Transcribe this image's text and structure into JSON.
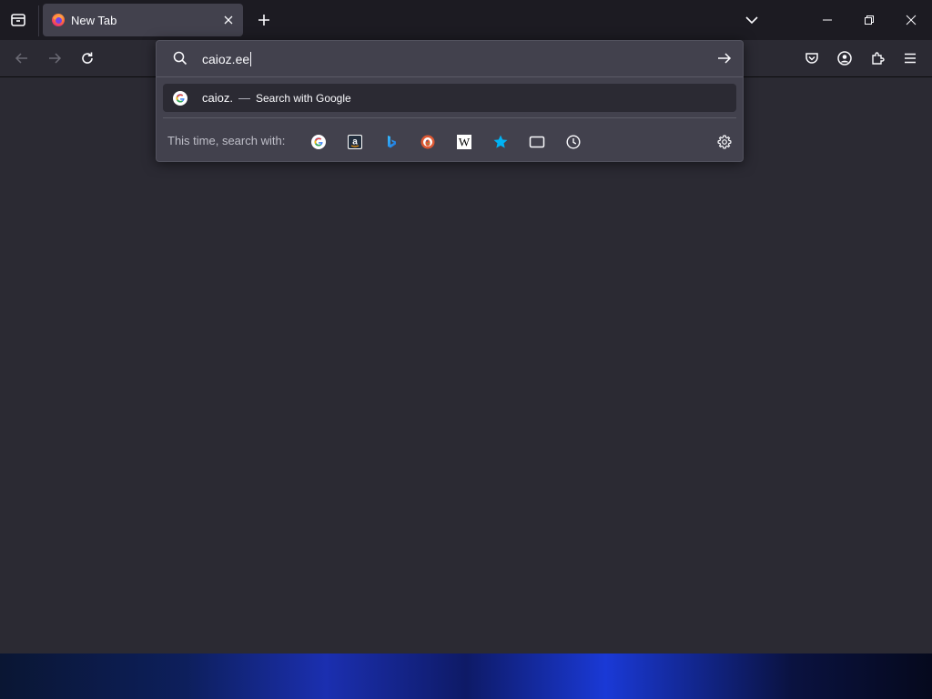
{
  "tab": {
    "title": "New Tab",
    "favicon": "firefox-icon"
  },
  "urlbar": {
    "value": "caioz.ee",
    "search_icon": "search-icon",
    "go_icon": "arrow-right-icon"
  },
  "suggestion": {
    "query": "caioz.",
    "separator": "—",
    "action": "Search with Google",
    "engine_icon": "google-icon"
  },
  "one_offs": {
    "label": "This time, search with:",
    "engines": [
      "google-icon",
      "amazon-icon",
      "bing-icon",
      "duckduckgo-icon",
      "wikipedia-icon",
      "bookmarks-star-icon",
      "tabs-icon",
      "history-icon"
    ],
    "settings_icon": "gear-icon"
  },
  "toolbar": {
    "icons": [
      "back-arrow-icon",
      "forward-arrow-icon",
      "reload-icon",
      "pocket-icon",
      "account-icon",
      "extensions-icon",
      "hamburger-menu-icon"
    ]
  },
  "titlebar": {
    "icons": [
      "firefox-view-icon",
      "new-tab-plus-icon",
      "list-all-tabs-chevron-icon",
      "minimize-icon",
      "restore-icon",
      "close-window-icon"
    ]
  },
  "colors": {
    "titlebar_bg": "#1c1b22",
    "toolbar_bg": "#2b2a33",
    "popup_bg": "#42414d",
    "text": "#fbfbfe",
    "accent_bookmark": "#00b3f4"
  }
}
